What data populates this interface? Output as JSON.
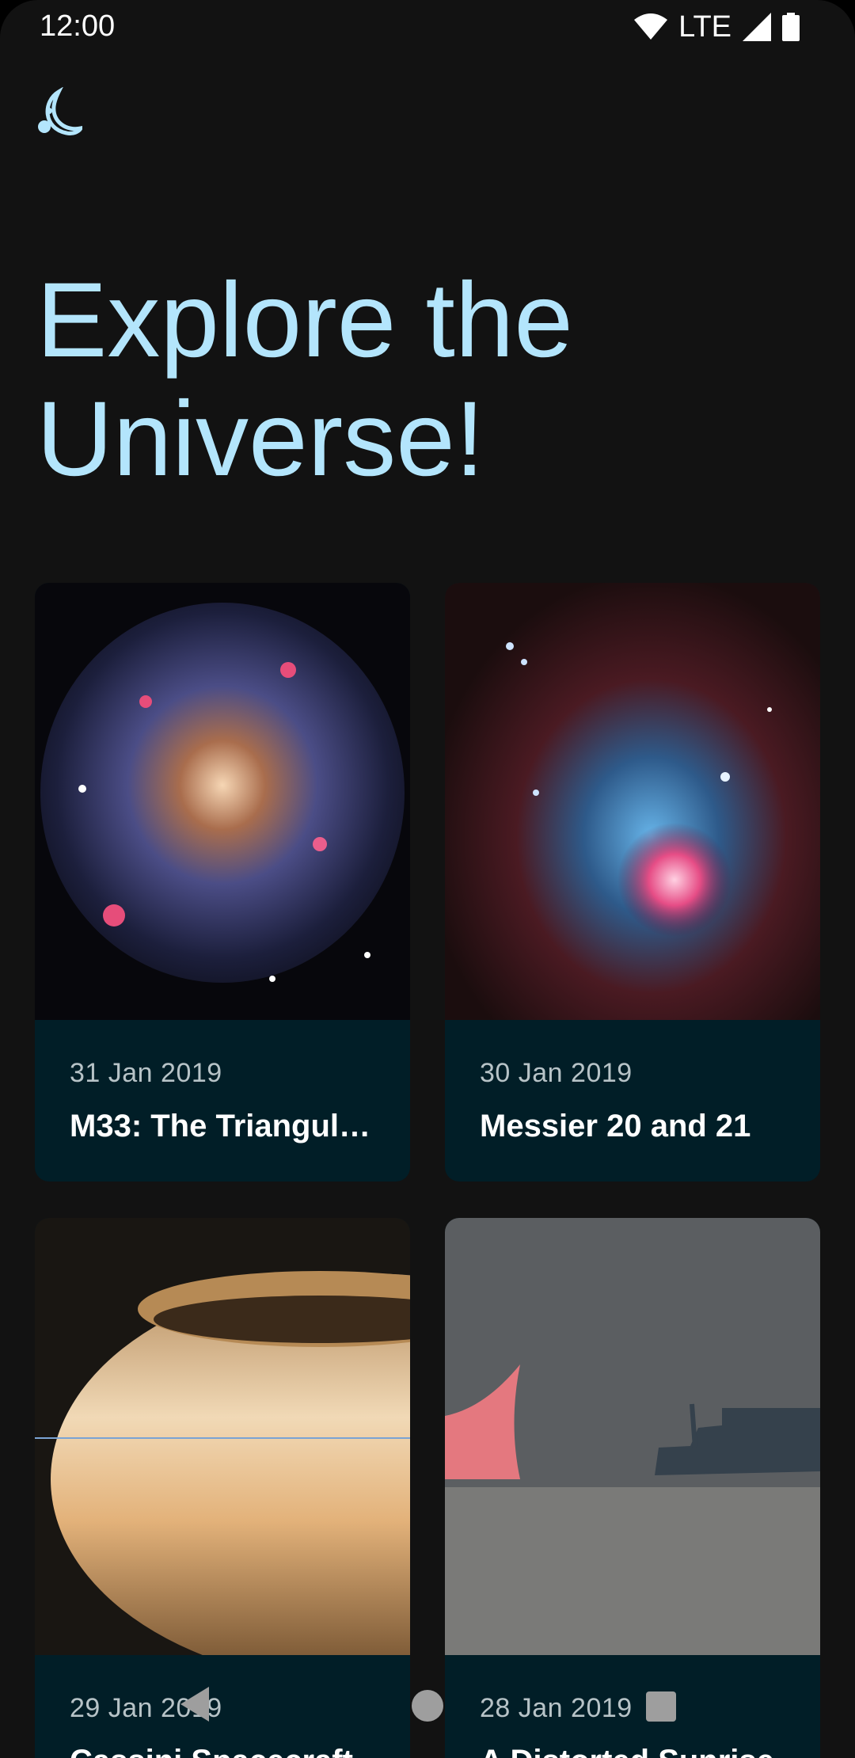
{
  "status_bar": {
    "time": "12:00",
    "network": "LTE"
  },
  "app": {
    "logo_icon": "moon-logo-icon",
    "accent_color": "#b3e5fc"
  },
  "headline": "Explore the Universe!",
  "cards": [
    {
      "date": "31 Jan 2019",
      "title": "M33: The Triangulu…",
      "image": "spiral-galaxy-image"
    },
    {
      "date": "30 Jan 2019",
      "title": "Messier 20 and 21",
      "image": "nebula-image"
    },
    {
      "date": "29 Jan 2019",
      "title": "Cassini Spacecraft",
      "image": "saturn-image"
    },
    {
      "date": "28 Jan 2019",
      "title": "A Distorted Sunrise",
      "image": "sunrise-sea-image"
    }
  ],
  "nav": {
    "back_icon": "back-icon",
    "home_icon": "home-icon",
    "recents_icon": "recents-icon"
  }
}
